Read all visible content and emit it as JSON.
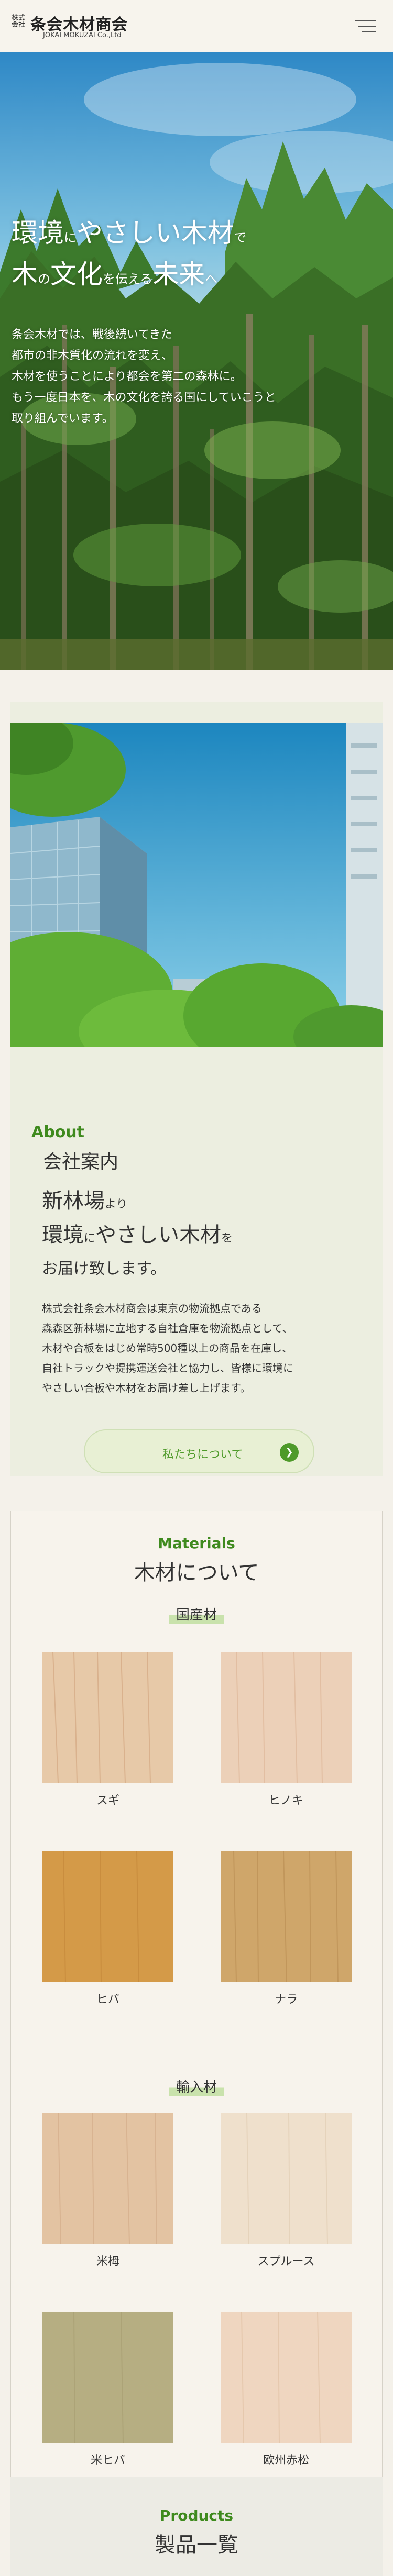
{
  "header": {
    "logo_prefix": "株式会社",
    "logo_name": "条会木材商会",
    "logo_sub": "JOKAI MOKUZAI Co.,Ltd"
  },
  "hero": {
    "title_line1": [
      "環境",
      "に",
      "やさしい木材",
      "で"
    ],
    "title_line2": [
      "木",
      "の",
      "文化",
      "を伝える",
      "未来",
      "へ"
    ],
    "text_lines": [
      "条会木材では、戦後続いてきた",
      "都市の非木質化の流れを変え、",
      "木材を使うことにより都会を第二の森林に。",
      "もう一度日本を、木の文化を誇る国にしていこうと",
      "取り組んでいます。"
    ]
  },
  "about": {
    "en": "About",
    "jp": "会社案内",
    "head_line1": [
      "新林場",
      "より"
    ],
    "head_line2": [
      "環境",
      "に",
      "やさしい木材",
      "を"
    ],
    "head_line3": "お届け致します。",
    "body_lines": [
      "株式会社条会木材商会は東京の物流拠点である",
      "森森区新林場に立地する自社倉庫を物流拠点として、",
      "木材や合板をはじめ常時500種以上の商品を在庫し、",
      "自社トラックや提携運送会社と協力し、皆様に環境に",
      "やさしい合板や木材をお届け差し上げます。"
    ],
    "button_label": "私たちについて",
    "button_icon": "chevron-right-icon"
  },
  "materials": {
    "en": "Materials",
    "jp": "木材について",
    "domestic_tag": "国産材",
    "imported_tag": "輸入材",
    "domestic": [
      {
        "name": "スギ",
        "color": "#e7c9a8"
      },
      {
        "name": "ヒノキ",
        "color": "#ecd0b8"
      },
      {
        "name": "ヒバ",
        "color": "#d49a48"
      },
      {
        "name": "ナラ",
        "color": "#cfa66a"
      }
    ],
    "imported": [
      {
        "name": "米栂",
        "color": "#e3c3a2"
      },
      {
        "name": "スプルース",
        "color": "#efe0cc"
      },
      {
        "name": "米ヒバ",
        "color": "#b6ae82"
      },
      {
        "name": "欧州赤松",
        "color": "#efd6c0"
      }
    ]
  },
  "products": {
    "en": "Products",
    "jp": "製品一覧"
  },
  "colors": {
    "accent_green": "#3f8a1e",
    "button_green": "#4e9a2a",
    "background": "#f4f1ea"
  }
}
